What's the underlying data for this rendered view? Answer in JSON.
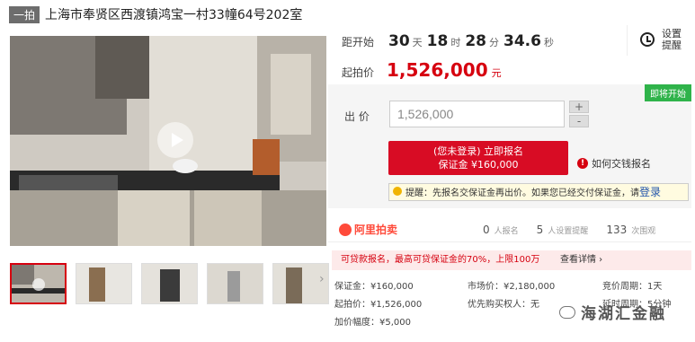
{
  "header": {
    "badge": "一拍",
    "title": "上海市奉贤区西渡镇鸿宝一村33幢64号202室"
  },
  "countdown": {
    "label": "距开始",
    "days": "30",
    "days_unit": "天",
    "hours": "18",
    "hours_unit": "时",
    "minutes": "28",
    "minutes_unit": "分",
    "seconds": "34.6",
    "seconds_unit": "秒"
  },
  "reminder": {
    "line1": "设置",
    "line2": "提醒"
  },
  "starting_price": {
    "label": "起拍价",
    "value": "1,526,000",
    "unit": "元"
  },
  "bid": {
    "tag": "即将开始",
    "label": "出 价",
    "input_value": "1,526,000",
    "plus": "+",
    "minus": "-",
    "signup_line1": "(您未登录) 立即报名",
    "signup_line2": "保证金 ¥160,000",
    "help_text": "如何交钱报名",
    "tip_text": "提醒：先报名交保证金再出价。如果您已经交付保证金，请",
    "tip_link": "登录"
  },
  "stats": {
    "logo_text": "阿里拍卖",
    "applicants_count": "0",
    "applicants_label": "人报名",
    "reminders_count": "5",
    "reminders_label": "人设置提醒",
    "views_count": "133",
    "views_label": "次围观"
  },
  "notice": {
    "text": "可贷款报名，最高可贷保证金的70%，上限100万",
    "detail": "查看详情 ›"
  },
  "info": {
    "deposit": "保证金：¥160,000",
    "market_price": "市场价：¥2,180,000",
    "bidding_cycle": "竞价周期：1天",
    "start_price": "起拍价：¥1,526,000",
    "priority": "优先购买权人：无",
    "extension": "延时周期：5分钟",
    "increment": "加价幅度：¥5,000"
  },
  "watermark": "海湖汇金融",
  "colors": {
    "accent": "#d6000f",
    "button": "#d80c24",
    "tag": "#2fb34a"
  }
}
